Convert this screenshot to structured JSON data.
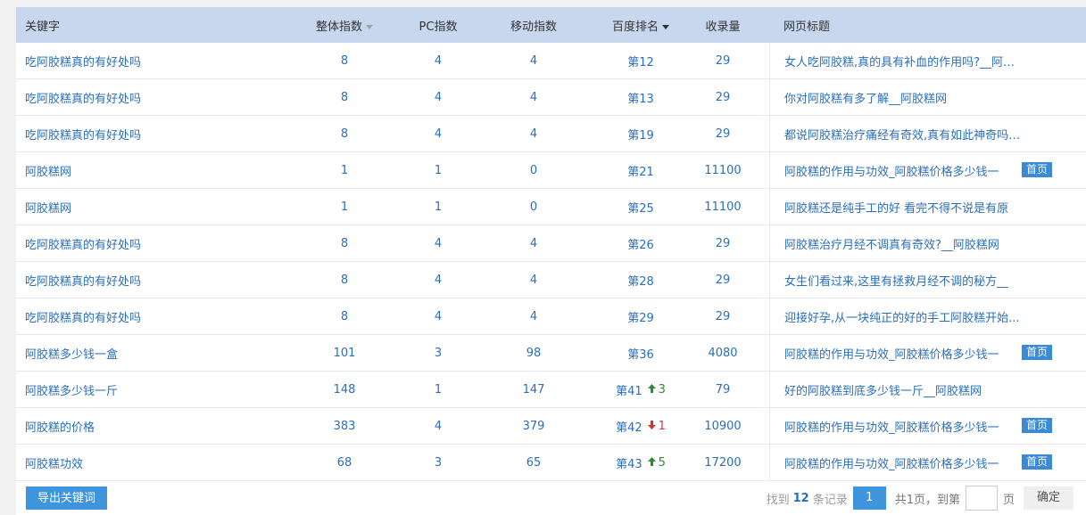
{
  "table": {
    "headers": {
      "keyword": "关键字",
      "total": "整体指数",
      "pc": "PC指数",
      "mobile": "移动指数",
      "rank": "百度排名",
      "records": "收录量",
      "title": "网页标题"
    },
    "rows": [
      {
        "keyword": "吃阿胶糕真的有好处吗",
        "total": "8",
        "pc": "4",
        "mobile": "4",
        "rank": "第12",
        "change": "",
        "change_dir": "",
        "records": "29",
        "title": "女人吃阿胶糕,真的具有补血的作用吗?__阿胶...",
        "badge": ""
      },
      {
        "keyword": "吃阿胶糕真的有好处吗",
        "total": "8",
        "pc": "4",
        "mobile": "4",
        "rank": "第13",
        "change": "",
        "change_dir": "",
        "records": "29",
        "title": "你对阿胶糕有多了解__阿胶糕网",
        "badge": ""
      },
      {
        "keyword": "吃阿胶糕真的有好处吗",
        "total": "8",
        "pc": "4",
        "mobile": "4",
        "rank": "第19",
        "change": "",
        "change_dir": "",
        "records": "29",
        "title": "都说阿胶糕治疗痛经有奇效,真有如此神奇吗?...",
        "badge": ""
      },
      {
        "keyword": "阿胶糕网",
        "total": "1",
        "pc": "1",
        "mobile": "0",
        "rank": "第21",
        "change": "",
        "change_dir": "",
        "records": "11100",
        "title": "阿胶糕的作用与功效_阿胶糕价格多少钱一",
        "badge": "首页"
      },
      {
        "keyword": "阿胶糕网",
        "total": "1",
        "pc": "1",
        "mobile": "0",
        "rank": "第25",
        "change": "",
        "change_dir": "",
        "records": "11100",
        "title": "阿胶糕还是纯手工的好 看完不得不说是有原",
        "badge": ""
      },
      {
        "keyword": "吃阿胶糕真的有好处吗",
        "total": "8",
        "pc": "4",
        "mobile": "4",
        "rank": "第26",
        "change": "",
        "change_dir": "",
        "records": "29",
        "title": "阿胶糕治疗月经不调真有奇效?__阿胶糕网",
        "badge": ""
      },
      {
        "keyword": "吃阿胶糕真的有好处吗",
        "total": "8",
        "pc": "4",
        "mobile": "4",
        "rank": "第28",
        "change": "",
        "change_dir": "",
        "records": "29",
        "title": "女生们看过来,这里有拯救月经不调的秘方__",
        "badge": ""
      },
      {
        "keyword": "吃阿胶糕真的有好处吗",
        "total": "8",
        "pc": "4",
        "mobile": "4",
        "rank": "第29",
        "change": "",
        "change_dir": "",
        "records": "29",
        "title": "迎接好孕,从一块纯正的好的手工阿胶糕开始...",
        "badge": ""
      },
      {
        "keyword": "阿胶糕多少钱一盒",
        "total": "101",
        "pc": "3",
        "mobile": "98",
        "rank": "第36",
        "change": "",
        "change_dir": "",
        "records": "4080",
        "title": "阿胶糕的作用与功效_阿胶糕价格多少钱一",
        "badge": "首页"
      },
      {
        "keyword": "阿胶糕多少钱一斤",
        "total": "148",
        "pc": "1",
        "mobile": "147",
        "rank": "第41",
        "change": "3",
        "change_dir": "up",
        "records": "79",
        "title": "好的阿胶糕到底多少钱一斤__阿胶糕网",
        "badge": ""
      },
      {
        "keyword": "阿胶糕的价格",
        "total": "383",
        "pc": "4",
        "mobile": "379",
        "rank": "第42",
        "change": "1",
        "change_dir": "down",
        "records": "10900",
        "title": "阿胶糕的作用与功效_阿胶糕价格多少钱一",
        "badge": "首页"
      },
      {
        "keyword": "阿胶糕功效",
        "total": "68",
        "pc": "3",
        "mobile": "65",
        "rank": "第43",
        "change": "5",
        "change_dir": "up",
        "records": "17200",
        "title": "阿胶糕的作用与功效_阿胶糕价格多少钱一",
        "badge": "首页"
      }
    ]
  },
  "footer": {
    "export_label": "导出关键词",
    "found_prefix": "找到",
    "found_count": "12",
    "found_suffix": "条记录",
    "current_page": "1",
    "pages_text": "共1页，到第",
    "page_unit": "页",
    "goto_value": "",
    "confirm_label": "确定"
  },
  "colors": {
    "accent": "#3f95dd",
    "header_bg": "#c9d7ee",
    "link": "#2a6ebb",
    "up": "#2e8b2e",
    "down": "#d33333"
  }
}
